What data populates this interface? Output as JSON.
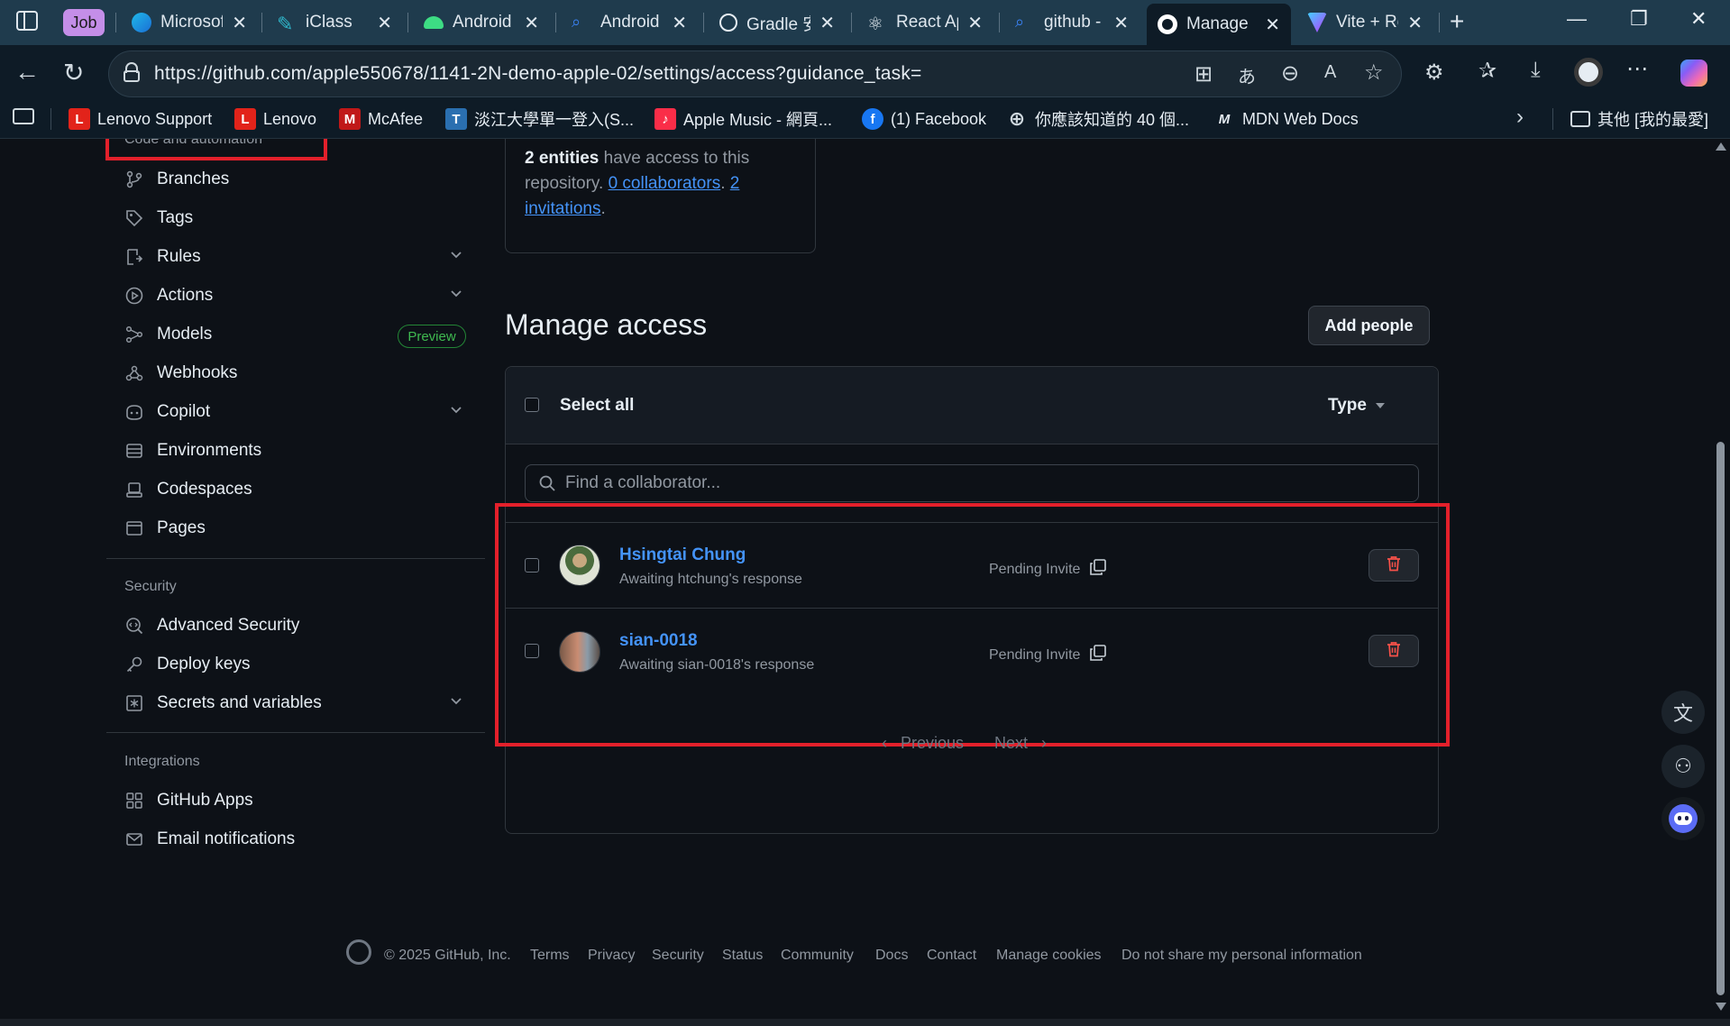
{
  "browser": {
    "tabs": [
      {
        "label": "Job",
        "type": "group"
      },
      {
        "label": "Microsof",
        "color": "#1a8fe3"
      },
      {
        "label": "iClass",
        "color": "#2fb5c9"
      },
      {
        "label": "Android",
        "color": "#3ddc84"
      },
      {
        "label": "Android",
        "color": "#3b82f6"
      },
      {
        "label": "Gradle 安",
        "color": "#ffffff"
      },
      {
        "label": "React Ap",
        "color": "#61dafb"
      },
      {
        "label": "github -",
        "color": "#3b82f6"
      },
      {
        "label": "Manage",
        "color": "#ffffff",
        "active": true
      },
      {
        "label": "Vite + Re",
        "color": "#bd34fe"
      }
    ],
    "url": "https://github.com/apple550678/1141-2N-demo-apple-02/settings/access?guidance_task=",
    "bookmarks": [
      {
        "label": "Lenovo Support",
        "icon": "L",
        "color": "#e2231a"
      },
      {
        "label": "Lenovo",
        "icon": "L",
        "color": "#e2231a"
      },
      {
        "label": "McAfee",
        "icon": "M",
        "color": "#c01818"
      },
      {
        "label": "淡江大學單一登入(S...",
        "icon": "T",
        "color": "#2a6fb0"
      },
      {
        "label": "Apple Music - 網頁...",
        "icon": "♪",
        "color": "#fa2d48"
      },
      {
        "label": "(1) Facebook",
        "icon": "f",
        "color": "#1877f2"
      },
      {
        "label": "你應該知道的 40 個...",
        "icon": "⊕",
        "color": "#0e1b26"
      },
      {
        "label": "MDN Web Docs",
        "icon": "M",
        "color": "#0e1b26"
      }
    ],
    "other_bookmarks": "其他 [我的最愛]"
  },
  "sidebar": {
    "section_code": "Code and automation",
    "code_items": [
      {
        "label": "Branches",
        "icon": "branch-icon"
      },
      {
        "label": "Tags",
        "icon": "tag-icon"
      },
      {
        "label": "Rules",
        "icon": "rules-icon",
        "expandable": true
      },
      {
        "label": "Actions",
        "icon": "play-icon",
        "expandable": true
      },
      {
        "label": "Models",
        "icon": "models-icon",
        "badge": "Preview"
      },
      {
        "label": "Webhooks",
        "icon": "webhook-icon"
      },
      {
        "label": "Copilot",
        "icon": "copilot-icon",
        "expandable": true
      },
      {
        "label": "Environments",
        "icon": "server-icon"
      },
      {
        "label": "Codespaces",
        "icon": "codespaces-icon"
      },
      {
        "label": "Pages",
        "icon": "browser-icon"
      }
    ],
    "section_security": "Security",
    "security_items": [
      {
        "label": "Advanced Security",
        "icon": "codescan-icon"
      },
      {
        "label": "Deploy keys",
        "icon": "key-icon"
      },
      {
        "label": "Secrets and variables",
        "icon": "asterisk-icon",
        "expandable": true
      }
    ],
    "section_integrations": "Integrations",
    "integration_items": [
      {
        "label": "GitHub Apps",
        "icon": "apps-icon"
      },
      {
        "label": "Email notifications",
        "icon": "mail-icon"
      }
    ]
  },
  "summary": {
    "count": "2 entities",
    "text1": " have access to this",
    "text2": "repository. ",
    "collaborators": "0 collaborators",
    "sep": ". ",
    "invitations_a": "2",
    "invitations_b": "invitations",
    "end": "."
  },
  "manage": {
    "title": "Manage access",
    "add_button": "Add people",
    "select_all": "Select all",
    "type_filter": "Type",
    "search_placeholder": "Find a collaborator...",
    "rows": [
      {
        "name": "Hsingtai Chung",
        "subtitle": "Awaiting htchung's response",
        "status": "Pending Invite"
      },
      {
        "name": "sian-0018",
        "subtitle": "Awaiting sian-0018's response",
        "status": "Pending Invite"
      }
    ],
    "pagination": {
      "prev": "Previous",
      "next": "Next"
    }
  },
  "footer": {
    "copyright": "© 2025 GitHub, Inc.",
    "links": [
      "Terms",
      "Privacy",
      "Security",
      "Status",
      "Community",
      "Docs",
      "Contact",
      "Manage cookies",
      "Do not share my personal information"
    ]
  },
  "colors": {
    "accent": "#4493f8",
    "highlight": "#e3202b",
    "danger": "#f85149",
    "success": "#3fb950"
  }
}
